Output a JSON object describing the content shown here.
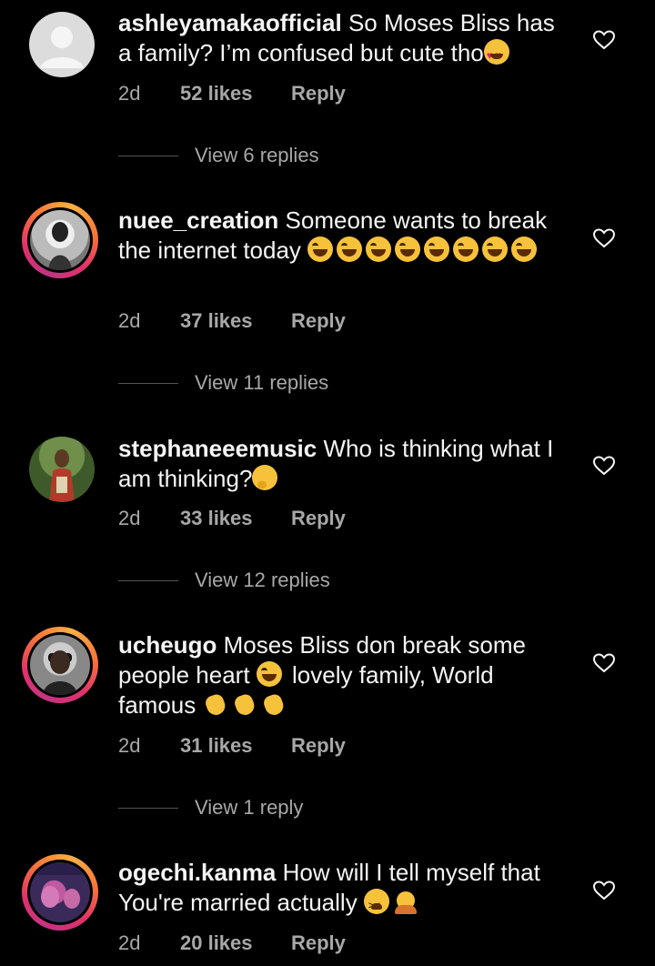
{
  "comments": [
    {
      "username": "ashleyamakaofficial",
      "text": "So Moses Bliss has a family? I’m confused but cute tho",
      "emojis": [
        "heart-eyes-emoji"
      ],
      "time": "2d",
      "likes": "52 likes",
      "reply": "Reply",
      "view_replies": "View 6 replies",
      "avatar": "default-avatar"
    },
    {
      "username": "nuee_creation",
      "text": "Someone wants to break the internet today",
      "emojis": [
        "laughing-crying-emoji",
        "laughing-crying-emoji",
        "laughing-crying-emoji",
        "laughing-crying-emoji",
        "laughing-crying-emoji",
        "laughing-crying-emoji",
        "laughing-crying-emoji",
        "laughing-crying-emoji"
      ],
      "time": "2d",
      "likes": "37 likes",
      "reply": "Reply",
      "view_replies": "View 11 replies",
      "avatar": "story-ring-avatar"
    },
    {
      "username": "stephaneeemusic",
      "text": "Who is thinking what I am thinking?",
      "emojis": [
        "thinking-emoji"
      ],
      "time": "2d",
      "likes": "33 likes",
      "reply": "Reply",
      "view_replies": "View 12 replies",
      "avatar": "photo-avatar"
    },
    {
      "username": "ucheugo",
      "text_a": "Moses Bliss don break some people heart",
      "text_b": "lovely family, World famous",
      "emojis": [
        "laughing-crying-emoji",
        "clapping-emoji",
        "clapping-emoji",
        "clapping-emoji"
      ],
      "time": "2d",
      "likes": "31 likes",
      "reply": "Reply",
      "view_replies": "View 1 reply",
      "avatar": "story-ring-avatar"
    },
    {
      "username": "ogechi.kanma",
      "text": "How will I tell myself that You're married actually",
      "emojis": [
        "tired-face-emoji",
        "facepalm-emoji"
      ],
      "time": "2d",
      "likes": "20 likes",
      "reply": "Reply",
      "avatar": "story-ring-avatar"
    }
  ],
  "colors": {
    "background": "#000000",
    "text": "#f5f5f5",
    "meta": "#a8a8a8",
    "ring_gradient": [
      "#c13584",
      "#e1306c",
      "#f77737",
      "#fcaf45"
    ]
  }
}
